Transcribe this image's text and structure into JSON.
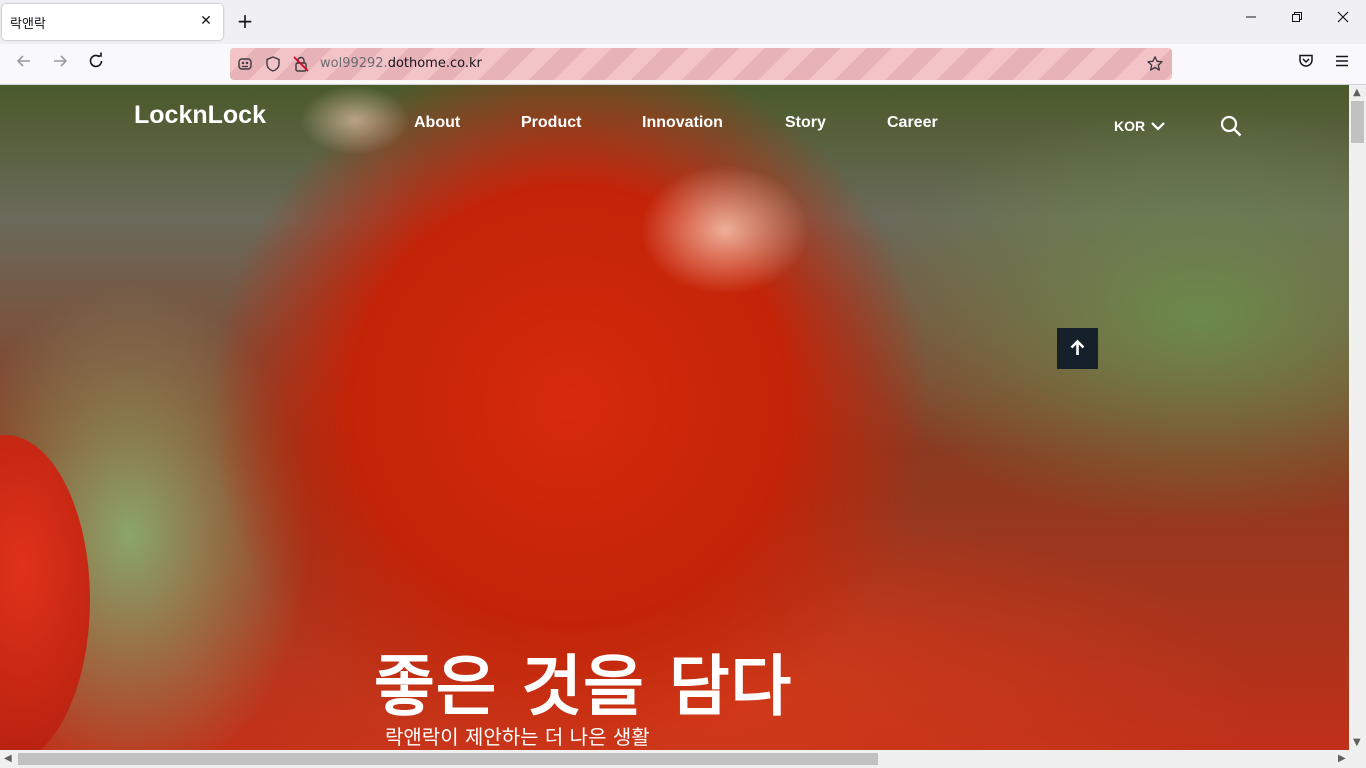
{
  "browser": {
    "tab_title": "락앤락",
    "url_dim": "wol99292.",
    "url_main": "dothome.co.kr"
  },
  "site": {
    "logo": "LocknLock",
    "nav": [
      "About",
      "Product",
      "Innovation",
      "Story",
      "Career"
    ],
    "lang": "KOR",
    "hero_title": "좋은 것을 담다",
    "hero_subtitle": "락앤락이 제안하는 더 나은 생활"
  },
  "colors": {
    "accent_dark": "#16202b",
    "url_tint": "#f2c4c8"
  }
}
